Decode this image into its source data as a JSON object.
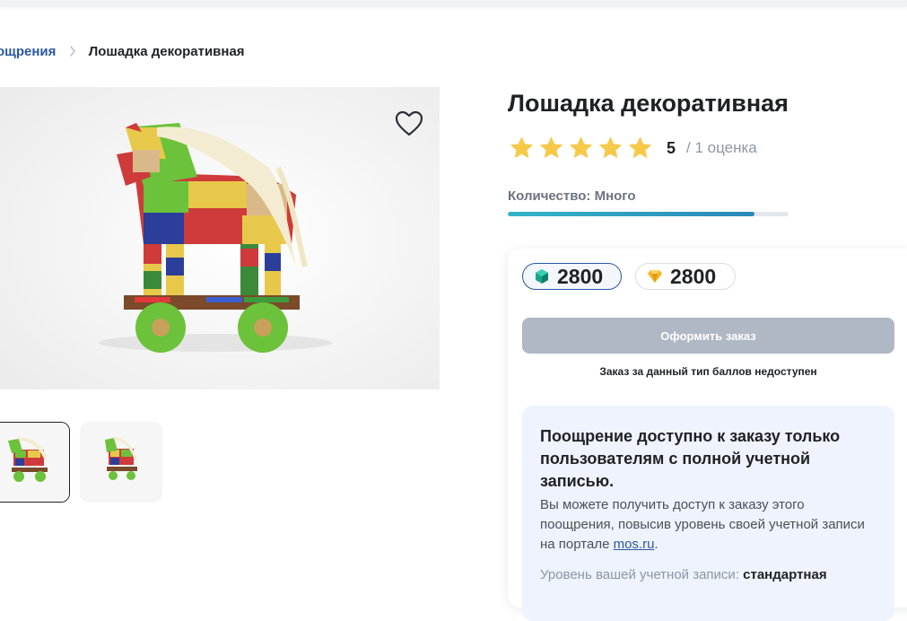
{
  "breadcrumb": {
    "parent": "ощрения",
    "current": "Лошадка декоративная"
  },
  "product": {
    "title": "Лошадка декоративная",
    "rating_value": "5",
    "rating_count": "/ 1 оценка",
    "stars_filled": 5,
    "quantity_label": "Количество: Много",
    "quantity_fraction": 0.88
  },
  "pricing": {
    "points_primary": "2800",
    "points_secondary": "2800",
    "order_button": "Оформить заказ",
    "order_note": "Заказ за данный тип баллов недоступен"
  },
  "info": {
    "title": "Поощрение доступно к заказу только пользователям с полной учетной записью.",
    "text_before_link": "Вы можете получить доступ к заказу этого поощрения, повысив уровень своей учетной записи на портале ",
    "link": "mos.ru",
    "text_after_link": ".",
    "level_label": "Уровень вашей учетной записи:",
    "level_value": "стандартная"
  },
  "icons": {
    "favorite": "heart-icon",
    "primary_points": "gem-icon",
    "secondary_points": "diamond-icon",
    "rating": "star-icon",
    "separator": "chevron-right-icon"
  },
  "colors": {
    "accent_blue": "#2b57a4",
    "star": "#f7c948",
    "button_disabled": "#b0b7c5",
    "info_bg": "#eef3fd",
    "progress": "#2a89b8"
  }
}
